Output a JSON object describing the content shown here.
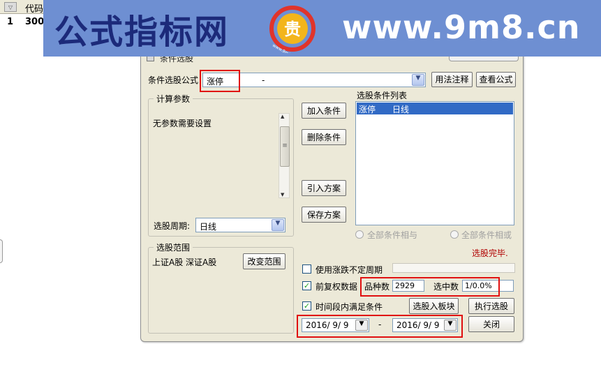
{
  "background_table": {
    "header_col": "代码",
    "row_num": "1",
    "row_code": "300"
  },
  "banner": {
    "left_text": "公式指标网",
    "right_text": "www.9m8.cn",
    "logo_char": "贵",
    "logo_url": "www.9m8.cn",
    "colors": {
      "bar": "#6e8fd2",
      "left_text": "#1c2a7a",
      "right_text": "#ffffff",
      "logo_ring": "#e0342b",
      "logo_gold": "#f3b51b"
    }
  },
  "dialog": {
    "title": "条件选股",
    "formula_label": "条件选股公式",
    "formula_value": "涨停",
    "formula_desc": "-",
    "usage_button": "用法注释",
    "view_formula_button": "查看公式",
    "params_group_title": "计算参数",
    "params_text": "无参数需要设置",
    "period_label": "选股周期:",
    "period_value": "日线",
    "add_condition_button": "加入条件",
    "delete_condition_button": "删除条件",
    "import_scheme_button": "引入方案",
    "save_scheme_button": "保存方案",
    "condition_list_label": "选股条件列表",
    "conditions": [
      {
        "name": "涨停",
        "period": "日线"
      }
    ],
    "radio_and": "全部条件相与",
    "radio_or": "全部条件相或",
    "status_text": "选股完毕.",
    "range_group_title": "选股范围",
    "range_text": "上证A股 深证A股",
    "change_range_button": "改变范围",
    "use_uncertain_period_label": "使用涨跌不定周期",
    "use_uncertain_period_checked": false,
    "adjusted_data_label": "前复权数据",
    "adjusted_data_checked": true,
    "stock_count_label": "品种数",
    "stock_count_value": "2929",
    "selected_label": "选中数",
    "selected_value": "1/0.0%",
    "time_range_label": "时间段内满足条件",
    "time_range_checked": true,
    "to_block_button": "选股入板块",
    "execute_button": "执行选股",
    "date_from": "2016/ 9/ 9",
    "date_sep": "-",
    "date_to": "2016/ 9/ 9",
    "close_button": "关闭",
    "colors": {
      "highlight": "#e01010",
      "selection": "#316ac5",
      "status": "#b00000"
    }
  }
}
